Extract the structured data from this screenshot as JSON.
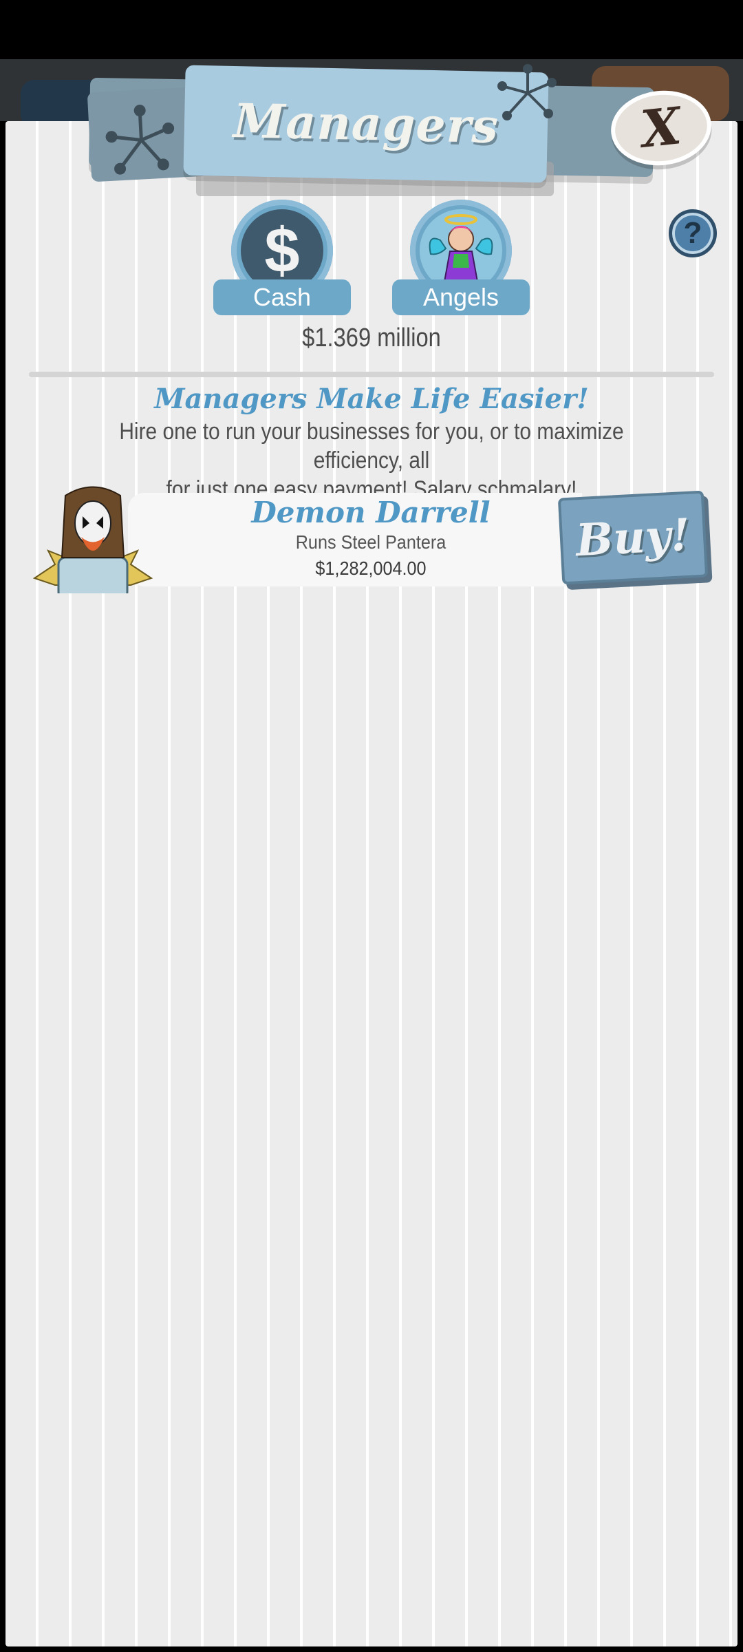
{
  "header": {
    "title": "Managers",
    "close_label": "X",
    "help_label": "?"
  },
  "currency_tabs": [
    {
      "label": "Cash",
      "icon": "dollar-icon",
      "symbol": "$"
    },
    {
      "label": "Angels",
      "icon": "angel-icon"
    }
  ],
  "cash_amount": "$1.369 million",
  "promo": {
    "title": "Managers Make Life Easier!",
    "line1": "Hire one to run your businesses for you, or to maximize efficiency, all",
    "line2": "for just one easy payment! Salary schmalary!"
  },
  "managers": [
    {
      "name": "Demon Darrell",
      "runs": "Runs Steel Pantera",
      "cost": "$1,282,004.00",
      "buy_label": "Buy!"
    }
  ],
  "colors": {
    "accent_blue": "#6ea8c9",
    "title_blue": "#4f97c4",
    "panel_bg": "#ececec"
  }
}
